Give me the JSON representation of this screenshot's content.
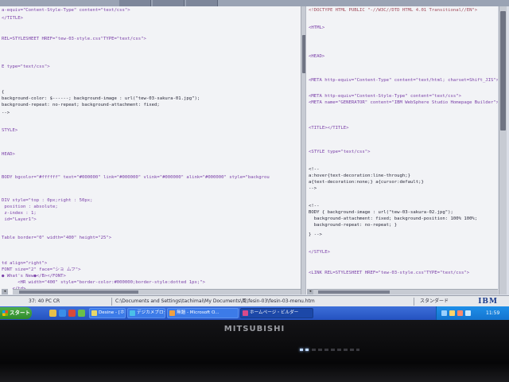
{
  "left_editor": {
    "lines": [
      {
        "t": "a-equiv=\"Content-Style-Type\" content=\"text/css\">",
        "c": "purple"
      },
      {
        "t": "</TITLE>",
        "c": "purple"
      },
      {
        "t": "REL=STYLESHEET HREF=\"tew-03-style.css\"TYPE=\"text/css\">",
        "c": "purple"
      },
      {
        "t": "E type=\"text/css\">",
        "c": "purple"
      },
      {
        "t": "{ ",
        "c": "dark"
      },
      {
        "t": "background-color: $------; background-image : url(\"tew-03-sakura-01.jpg\");",
        "c": "dark"
      },
      {
        "t": "background-repeat: no-repeat; background-attachment: fixed;",
        "c": "dark"
      },
      {
        "t": "-->",
        "c": "dark"
      },
      {
        "t": "STYLE>",
        "c": "purple"
      },
      {
        "t": "HEAD>",
        "c": "purple"
      },
      {
        "t": "BODY bgcolor=\"#ffffff\" text=\"#000000\" link=\"#000000\" vlink=\"#000000\" alink=\"#000000\" style=\"backgrou",
        "c": "purple"
      },
      {
        "t": "DIV style=\"top : 0px;right : 50px;",
        "c": "purple"
      },
      {
        "t": " position : absolute;",
        "c": "purple"
      },
      {
        "t": " z-index : 1;",
        "c": "purple"
      },
      {
        "t": " id=\"Layer1\">",
        "c": "purple"
      },
      {
        "t": "Table border=\"0\" width=\"400\" height=\"25\">",
        "c": "purple"
      },
      {
        "t": "td align=\"right\">",
        "c": "purple"
      },
      {
        "t": "FONT size=\"2\" face=\"ショ ムフ\">",
        "c": "purple"
      },
      {
        "t": "● What's New●</B></FONT>",
        "c": "purple"
      },
      {
        "t": "      <HR width=\"400\" style=\"border-color:#000000;border-style:dotted 1px;\">",
        "c": "purple"
      },
      {
        "t": "    </td>",
        "c": "purple"
      }
    ]
  },
  "right_editor": {
    "lines": [
      {
        "t": "<!DOCTYPE HTML PUBLIC \"-//W3C//DTD HTML 4.01 Transitional//EN\">",
        "c": "red"
      },
      {
        "t": "<HTML>",
        "c": "purple"
      },
      {
        "t": "<HEAD>",
        "c": "purple"
      },
      {
        "t": "<META http-equiv=\"Content-Type\" content=\"text/html; charset=Shift_JIS\">",
        "c": "purple"
      },
      {
        "t": "<META http-equiv=\"Content-Style-Type\" content=\"text/css\">",
        "c": "purple"
      },
      {
        "t": "<META name=\"GENERATOR\" content=\"IBM WebSphere Studio Homepage Builder\">",
        "c": "purple"
      },
      {
        "t": "<TITLE></TITLE>",
        "c": "purple"
      },
      {
        "t": "<STYLE type=\"text/css\">",
        "c": "purple"
      },
      {
        "t": "<!--",
        "c": "dark"
      },
      {
        "t": "a:hover{text-decoration:line-through;}",
        "c": "dark"
      },
      {
        "t": "a{text-decoration:none;} a{cursor:default;}",
        "c": "dark"
      },
      {
        "t": "-->",
        "c": "dark"
      },
      {
        "t": "<!--",
        "c": "dark"
      },
      {
        "t": "BODY { background-image : url(\"tew-03-sakura-02.jpg\");",
        "c": "dark"
      },
      {
        "t": "  background-attachment: fixed; background-position: 100% 100%;",
        "c": "dark"
      },
      {
        "t": "  background-repeat: no-repeat; }",
        "c": "dark"
      },
      {
        "t": "} -->",
        "c": "dark"
      },
      {
        "t": "</STYLE>",
        "c": "purple"
      },
      {
        "t": "<LINK REL=STYLESHEET HREF=\"tew-03-style.css\"TYPE=\"text/css\">",
        "c": "purple"
      }
    ]
  },
  "status_bar": {
    "position": "37: 40  PC CR",
    "path": "C:\\Documents and Settings\\tachimai\\My Documents\\風\\fesin-03\\fesin-03-menu.htm",
    "mode": "スタンダード",
    "brand": "IBM"
  },
  "taskbar": {
    "start_label": "スタート",
    "buttons": [
      {
        "label": "Desine - [ホームページ]",
        "active": false
      },
      {
        "label": "デジカメブログ ...",
        "active": false
      },
      {
        "label": "無題 - Microsoft O...",
        "active": false
      },
      {
        "label": "ホームページ・ビルダー",
        "active": true
      }
    ],
    "clock": "11:59"
  },
  "monitor": {
    "brand": "MITSUBISHI"
  }
}
